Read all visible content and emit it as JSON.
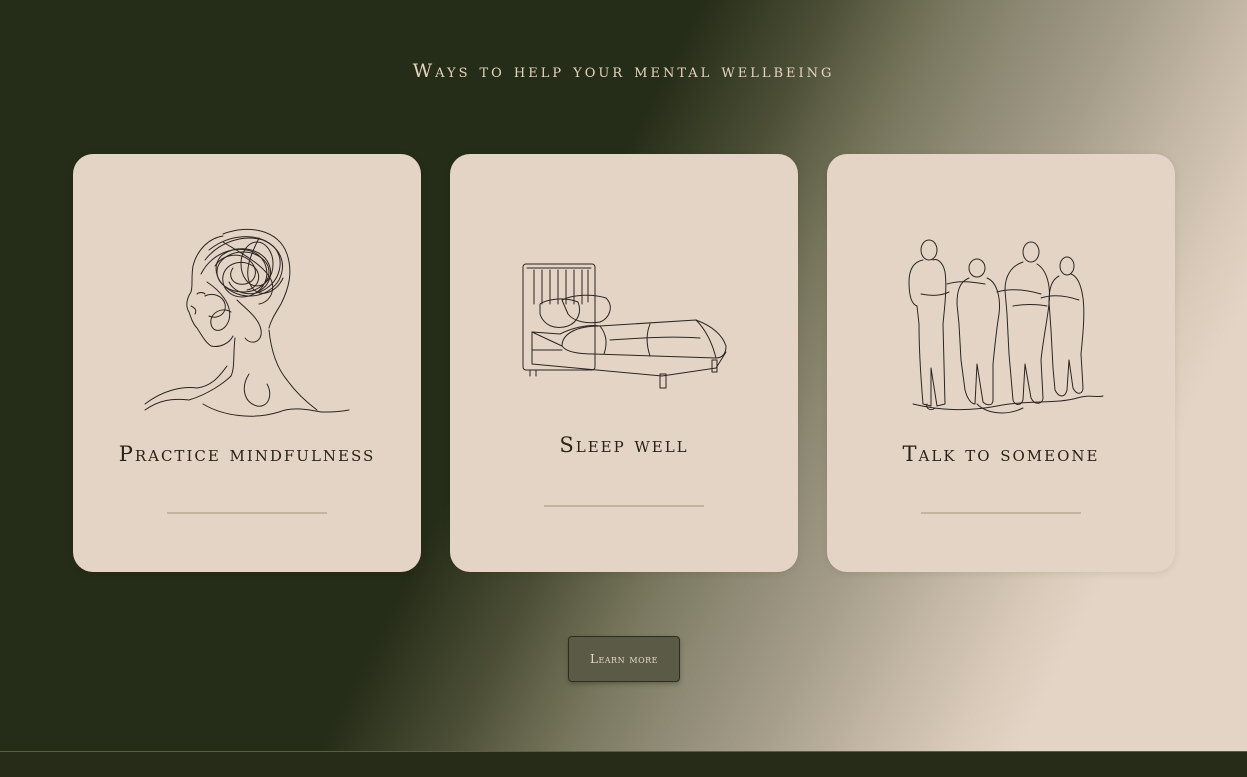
{
  "section": {
    "title": "Ways to help your mental wellbeing"
  },
  "cards": [
    {
      "title": "Practice mindfulness",
      "icon": "head-line-art-icon"
    },
    {
      "title": "Sleep well",
      "icon": "bed-line-art-icon"
    },
    {
      "title": "Talk to someone",
      "icon": "friends-group-line-art-icon"
    }
  ],
  "cta": {
    "label": "Learn more"
  },
  "colors": {
    "dark_green": "#252c17",
    "card_beige": "#e4d4c5",
    "title_cream": "#e4d4c1",
    "button_bg": "#5a5a47",
    "ink": "#2b2520"
  }
}
